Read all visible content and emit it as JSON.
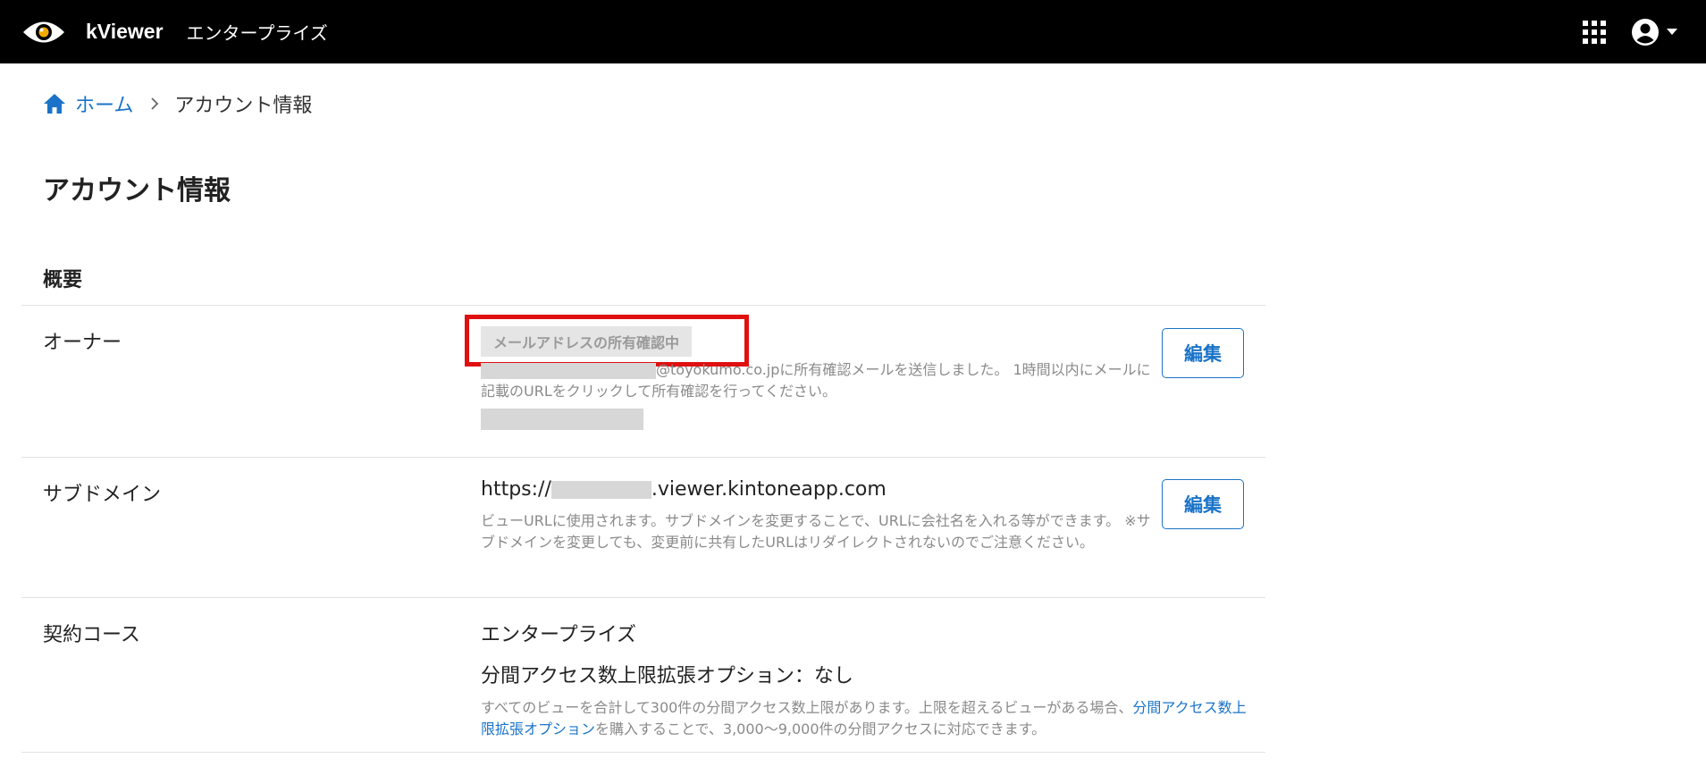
{
  "header": {
    "brand": "kViewer",
    "plan": "エンタープライズ"
  },
  "breadcrumb": {
    "home": "ホーム",
    "current": "アカウント情報"
  },
  "page": {
    "title": "アカウント情報",
    "section": "概要"
  },
  "owner": {
    "label": "オーナー",
    "status": "メールアドレスの所有確認中",
    "email_domain": "@toyokumo.co.jp",
    "message": "に所有確認メールを送信しました。 1時間以内にメールに記載のURLをクリックして所有確認を行ってください。",
    "edit": "編集"
  },
  "subdomain": {
    "label": "サブドメイン",
    "url_prefix": "https://",
    "url_suffix": ".viewer.kintoneapp.com",
    "help": "ビューURLに使用されます。サブドメインを変更することで、URLに会社名を入れる等ができます。 ※サブドメインを変更しても、変更前に共有したURLはリダイレクトされないのでご注意ください。",
    "edit": "編集"
  },
  "plan_row": {
    "label": "契約コース",
    "plan": "エンタープライズ",
    "option": "分間アクセス数上限拡張オプション：なし",
    "help_before": "すべてのビューを合計して300件の分間アクセス数上限があります。上限を超えるビューがある場合、",
    "help_link": "分間アクセス数上限拡張オプション",
    "help_after": "を購入することで、3,000〜9,000件の分間アクセスに対応できます。"
  }
}
